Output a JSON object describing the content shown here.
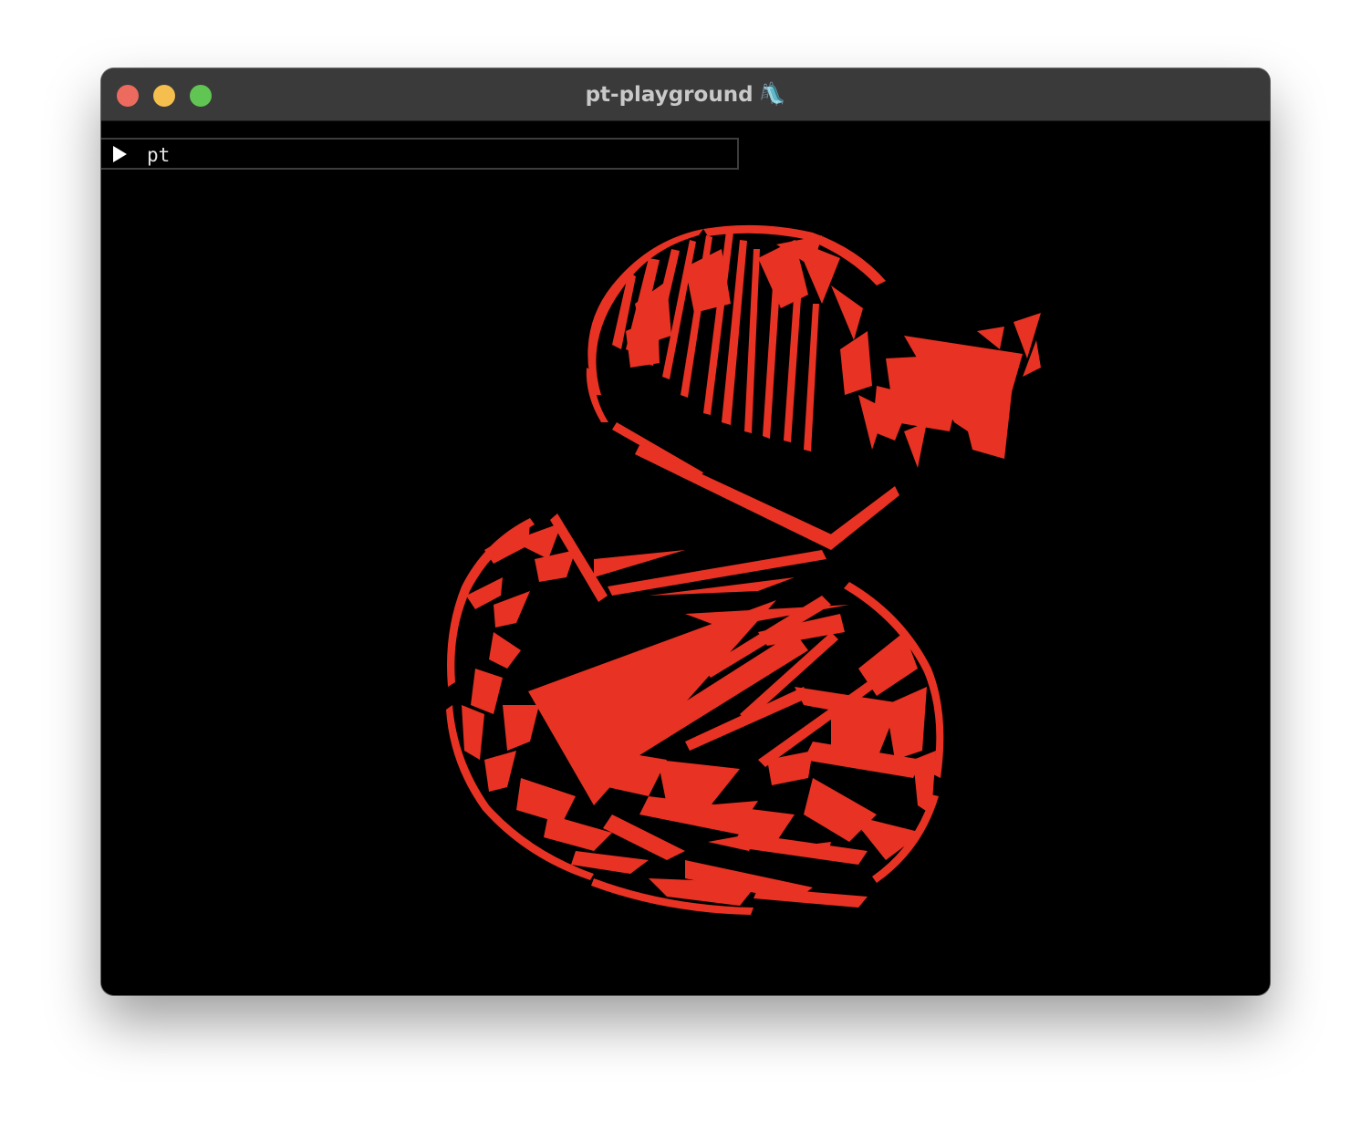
{
  "window": {
    "title": "pt-playground",
    "title_emoji": "🛝",
    "buttons": [
      "close",
      "minimize",
      "zoom"
    ]
  },
  "panel": {
    "tree_label": "pt",
    "expand_icon": "triangle-right-icon"
  },
  "scene": {
    "object": "duck-mesh",
    "fill_color": "#e83223",
    "background_color": "#000000"
  }
}
